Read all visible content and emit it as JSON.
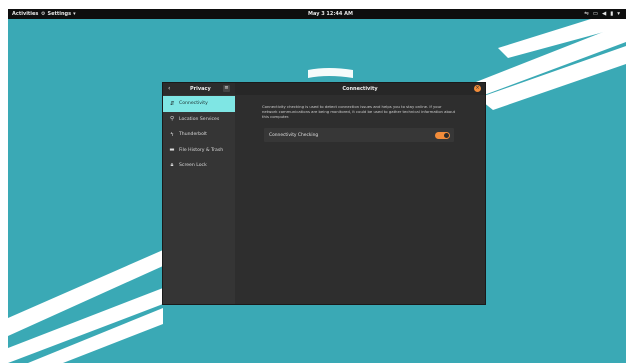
{
  "topbar": {
    "activities": "Activities",
    "app_name": "Settings",
    "clock": "May 3  12:44 AM",
    "tray_icons": [
      "network-icon",
      "display-icon",
      "volume-icon",
      "battery-icon",
      "chevron-down-icon"
    ]
  },
  "sidebar": {
    "title": "Privacy",
    "items": [
      {
        "label": "Connectivity",
        "icon": "connectivity-icon",
        "active": true
      },
      {
        "label": "Location Services",
        "icon": "location-icon",
        "active": false
      },
      {
        "label": "Thunderbolt",
        "icon": "thunderbolt-icon",
        "active": false
      },
      {
        "label": "File History & Trash",
        "icon": "folder-icon",
        "active": false
      },
      {
        "label": "Screen Lock",
        "icon": "lock-icon",
        "active": false
      }
    ]
  },
  "main": {
    "title": "Connectivity",
    "description": "Connectivity checking is used to detect connection issues and helps you to stay online. If your network communications are being monitored, it could be used to gather technical information about this computer.",
    "setting_label": "Connectivity Checking",
    "setting_enabled": true
  },
  "colors": {
    "desktop": "#3aa9b5",
    "accent": "#f28c3a",
    "selection": "#7fe6e4"
  }
}
